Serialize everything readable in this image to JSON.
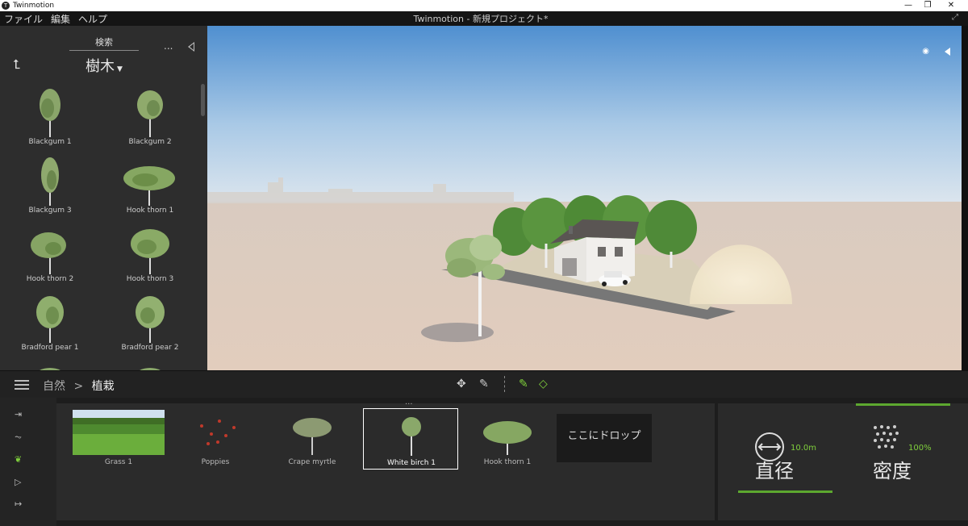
{
  "window": {
    "app_name": "Twinmotion",
    "controls": [
      "—",
      "❐",
      "✕"
    ]
  },
  "menu": {
    "items": [
      "ファイル",
      "編集",
      "ヘルプ"
    ],
    "title": "Twinmotion - 新規プロジェクト*"
  },
  "library": {
    "search_label": "検索",
    "more": "...",
    "category": "樹木",
    "items": [
      "Blackgum 1",
      "Blackgum 2",
      "Blackgum 3",
      "Hook thorn 1",
      "Hook thorn 2",
      "Hook thorn 3",
      "Bradford pear 1",
      "Bradford pear 2"
    ]
  },
  "toolbar": {
    "breadcrumb_parent": "自然",
    "breadcrumb_sep": ">",
    "breadcrumb_current": "植栽"
  },
  "assets": {
    "handle": "...",
    "items": [
      {
        "label": "Grass 1"
      },
      {
        "label": "Poppies"
      },
      {
        "label": "Crape myrtle"
      },
      {
        "label": "White birch 1",
        "selected": true
      },
      {
        "label": "Hook thorn 1"
      }
    ],
    "drop_label": "ここにドロップ"
  },
  "params": {
    "diameter_label": "直径",
    "diameter_value": "10.0m",
    "density_label": "密度",
    "density_value": "100%"
  },
  "colors": {
    "accent_green": "#5da82f",
    "panel": "#2d2d2d",
    "sky_top": "#4f8fd0",
    "ground": "#dcc9ba"
  }
}
